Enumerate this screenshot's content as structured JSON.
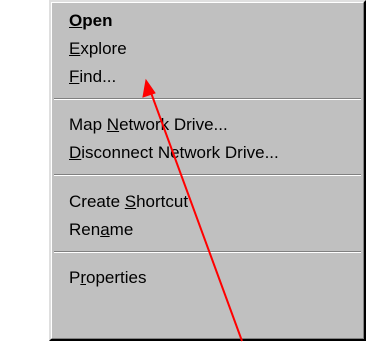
{
  "menu": {
    "groups": [
      {
        "items": [
          {
            "before": "",
            "acc": "O",
            "after": "pen",
            "default": true
          },
          {
            "before": "",
            "acc": "E",
            "after": "xplore",
            "default": false
          },
          {
            "before": "",
            "acc": "F",
            "after": "ind...",
            "default": false
          }
        ]
      },
      {
        "items": [
          {
            "before": "Map ",
            "acc": "N",
            "after": "etwork Drive...",
            "default": false
          },
          {
            "before": "",
            "acc": "D",
            "after": "isconnect Network Drive...",
            "default": false
          }
        ]
      },
      {
        "items": [
          {
            "before": "Create ",
            "acc": "S",
            "after": "hortcut",
            "default": false
          },
          {
            "before": "Ren",
            "acc": "a",
            "after": "me",
            "default": false
          }
        ]
      },
      {
        "items": [
          {
            "before": "P",
            "acc": "r",
            "after": "operties",
            "default": false
          }
        ]
      }
    ]
  },
  "annotation": {
    "arrow_color": "#ff0000",
    "target_item": "Explore"
  },
  "colors": {
    "menu_face": "#c0c0c0",
    "highlight": "#ffffff",
    "shadow": "#808080",
    "dark_shadow": "#000000"
  }
}
